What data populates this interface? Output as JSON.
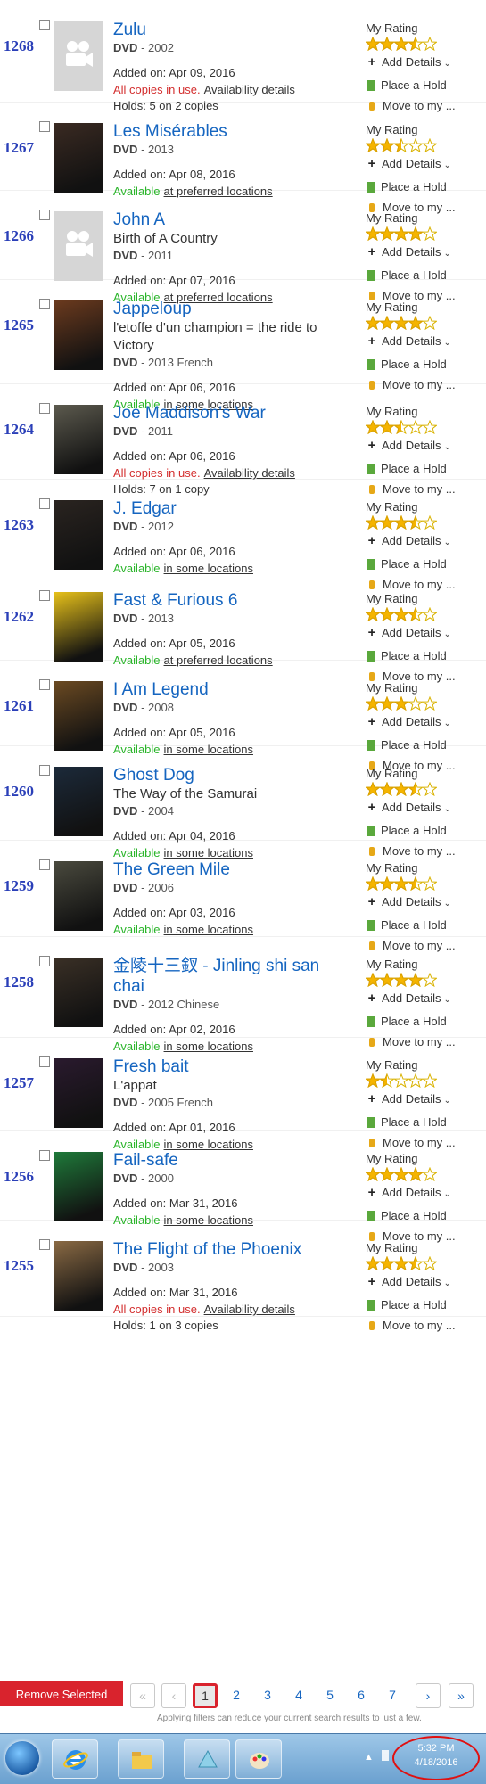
{
  "my_rating_label": "My Rating",
  "actions": {
    "add_details": "Add Details",
    "place_hold": "Place a Hold",
    "move_to": "Move to my ..."
  },
  "items": [
    {
      "num": "1268",
      "title": "Zulu",
      "subtitle": "",
      "format": "DVD",
      "meta": " - 2002",
      "added": "Added on: Apr 09, 2016",
      "status": "All copies in use.",
      "status_ok": false,
      "status_link": "Availability details",
      "holds": "Holds: 5 on 2 copies",
      "rating": 3.5,
      "cover": "placeholder"
    },
    {
      "num": "1267",
      "title": "Les Misérables",
      "subtitle": "",
      "format": "DVD",
      "meta": " - 2013",
      "added": "Added on: Apr 08, 2016",
      "status": "Available",
      "status_ok": true,
      "status_link": "at preferred locations",
      "holds": "",
      "rating": 2.5,
      "cover": "#3a2a22"
    },
    {
      "num": "1266",
      "title": "John A",
      "subtitle": "Birth of A Country",
      "format": "DVD",
      "meta": " - 2011",
      "added": "Added on: Apr 07, 2016",
      "status": "Available",
      "status_ok": true,
      "status_link": "at preferred locations",
      "holds": "",
      "rating": 4,
      "cover": "placeholder"
    },
    {
      "num": "1265",
      "title": "Jappeloup",
      "subtitle": "l'etoffe d'un champion = the ride to Victory",
      "format": "DVD",
      "meta": " - 2013 French",
      "added": "Added on: Apr 06, 2016",
      "status": "Available",
      "status_ok": true,
      "status_link": "in some locations",
      "holds": "",
      "rating": 4,
      "cover": "#6b3a1e"
    },
    {
      "num": "1264",
      "title": "Joe Maddison's War",
      "subtitle": "",
      "format": "DVD",
      "meta": " - 2011",
      "added": "Added on: Apr 06, 2016",
      "status": "All copies in use.",
      "status_ok": false,
      "status_link": "Availability details",
      "holds": "Holds: 7 on 1 copy",
      "rating": 2.5,
      "cover": "#5c5a4e"
    },
    {
      "num": "1263",
      "title": "J. Edgar",
      "subtitle": "",
      "format": "DVD",
      "meta": " - 2012",
      "added": "Added on: Apr 06, 2016",
      "status": "Available",
      "status_ok": true,
      "status_link": "in some locations",
      "holds": "",
      "rating": 3.5,
      "cover": "#2a2420"
    },
    {
      "num": "1262",
      "title": "Fast & Furious 6",
      "subtitle": "",
      "format": "DVD",
      "meta": " - 2013",
      "added": "Added on: Apr 05, 2016",
      "status": "Available",
      "status_ok": true,
      "status_link": "at preferred locations",
      "holds": "",
      "rating": 3.5,
      "cover": "#e8c21a"
    },
    {
      "num": "1261",
      "title": "I Am Legend",
      "subtitle": "",
      "format": "DVD",
      "meta": " - 2008",
      "added": "Added on: Apr 05, 2016",
      "status": "Available",
      "status_ok": true,
      "status_link": "in some locations",
      "holds": "",
      "rating": 3,
      "cover": "#6b4a22"
    },
    {
      "num": "1260",
      "title": "Ghost Dog",
      "subtitle": "The Way of the Samurai",
      "format": "DVD",
      "meta": " - 2004",
      "added": "Added on: Apr 04, 2016",
      "status": "Available",
      "status_ok": true,
      "status_link": "in some locations",
      "holds": "",
      "rating": 3.5,
      "cover": "#1c2a3a"
    },
    {
      "num": "1259",
      "title": "The Green Mile",
      "subtitle": "",
      "format": "DVD",
      "meta": " - 2006",
      "added": "Added on: Apr 03, 2016",
      "status": "Available",
      "status_ok": true,
      "status_link": "in some locations",
      "holds": "",
      "rating": 3.5,
      "cover": "#4a4a3e"
    },
    {
      "num": "1258",
      "title": "金陵十三釵 - Jinling shi san chai",
      "subtitle": "",
      "format": "DVD",
      "meta": " - 2012 Chinese",
      "added": "Added on: Apr 02, 2016",
      "status": "Available",
      "status_ok": true,
      "status_link": "in some locations",
      "holds": "",
      "rating": 4,
      "cover": "#3a3026"
    },
    {
      "num": "1257",
      "title": "Fresh bait",
      "subtitle": "L'appat",
      "format": "DVD",
      "meta": " - 2005 French",
      "added": "Added on: Apr 01, 2016",
      "status": "Available",
      "status_ok": true,
      "status_link": "in some locations",
      "holds": "",
      "rating": 1.5,
      "cover": "#2a1a2e"
    },
    {
      "num": "1256",
      "title": "Fail-safe",
      "subtitle": "",
      "format": "DVD",
      "meta": " - 2000",
      "added": "Added on: Mar 31, 2016",
      "status": "Available",
      "status_ok": true,
      "status_link": "in some locations",
      "holds": "",
      "rating": 4,
      "cover": "#1f7a3a"
    },
    {
      "num": "1255",
      "title": "The Flight of the Phoenix",
      "subtitle": "",
      "format": "DVD",
      "meta": " - 2003",
      "added": "Added on: Mar 31, 2016",
      "status": "All copies in use.",
      "status_ok": false,
      "status_link": "Availability details",
      "holds": "Holds: 1 on 3 copies",
      "rating": 3.5,
      "cover": "#8a6a44"
    }
  ],
  "remove_selected": "Remove Selected",
  "pagination": {
    "first": "«",
    "prev": "‹",
    "pages": [
      "1",
      "2",
      "3",
      "4",
      "5",
      "6",
      "7"
    ],
    "current": "1",
    "next": "›",
    "last": "»"
  },
  "hint": "Applying filters can reduce your current search results to just a few.",
  "taskbar": {
    "time": "5:32 PM",
    "date": "4/18/2016"
  },
  "colors": {
    "link_blue": "#1565c0",
    "available": "#2bb52b",
    "in_use": "#d32f2f",
    "star": "#f5b400",
    "remove": "#d9232d"
  }
}
